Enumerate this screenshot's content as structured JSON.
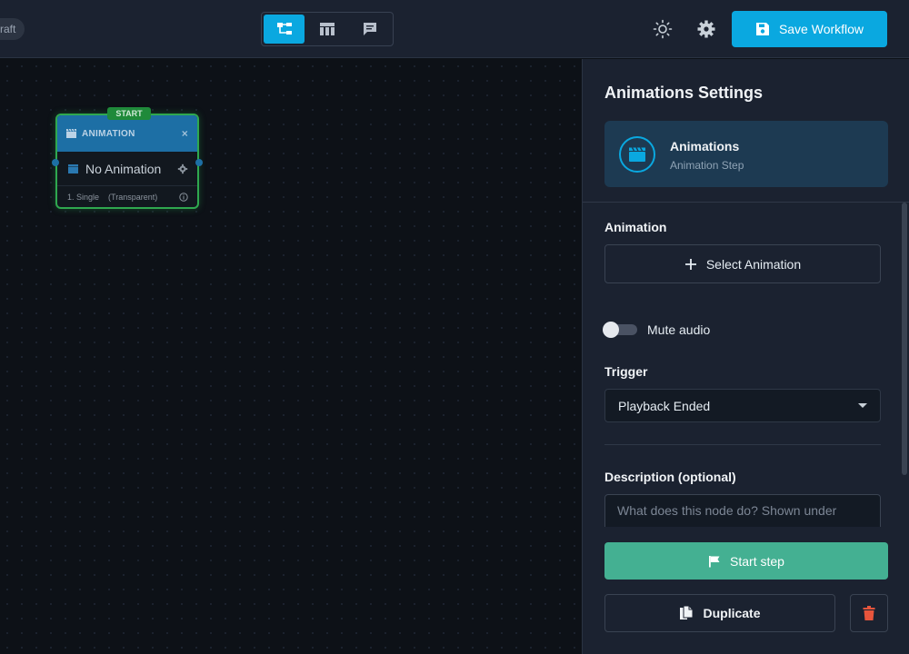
{
  "topbar": {
    "draft_label": "raft",
    "view_switch": [
      {
        "icon": "tree-view-icon",
        "active": true
      },
      {
        "icon": "table-view-icon",
        "active": false
      },
      {
        "icon": "comment-view-icon",
        "active": false
      }
    ],
    "theme_icon": "sun-icon",
    "settings_icon": "gear-icon",
    "save_label": "Save Workflow"
  },
  "node": {
    "start_badge": "START",
    "header": "ANIMATION",
    "close": "×",
    "body": "No Animation",
    "footer_left": "1. Single",
    "footer_mid": "(Transparent)"
  },
  "panel": {
    "title": "Animations Settings",
    "card": {
      "title": "Animations",
      "subtitle": "Animation Step"
    },
    "animation_label": "Animation",
    "select_animation": "Select Animation",
    "mute_audio": "Mute audio",
    "mute_audio_on": false,
    "trigger_label": "Trigger",
    "trigger_value": "Playback Ended",
    "description_label": "Description (optional)",
    "description_placeholder": "What does this node do? Shown under",
    "start_step": "Start step",
    "duplicate": "Duplicate"
  },
  "colors": {
    "accent": "#0aa8e0",
    "start_green": "#44b092",
    "delete_red": "#e8553c",
    "node_border": "#2fa84f"
  }
}
